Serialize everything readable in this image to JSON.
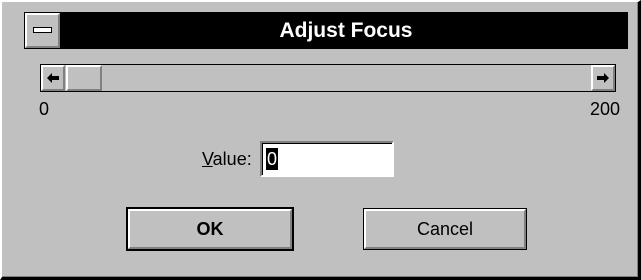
{
  "window": {
    "title": "Adjust Focus"
  },
  "scrollbar": {
    "min_label": "0",
    "max_label": "200",
    "value": 0
  },
  "value_field": {
    "label_prefix": "V",
    "label_rest": "alue:",
    "value": "0"
  },
  "buttons": {
    "ok": "OK",
    "cancel": "Cancel"
  }
}
